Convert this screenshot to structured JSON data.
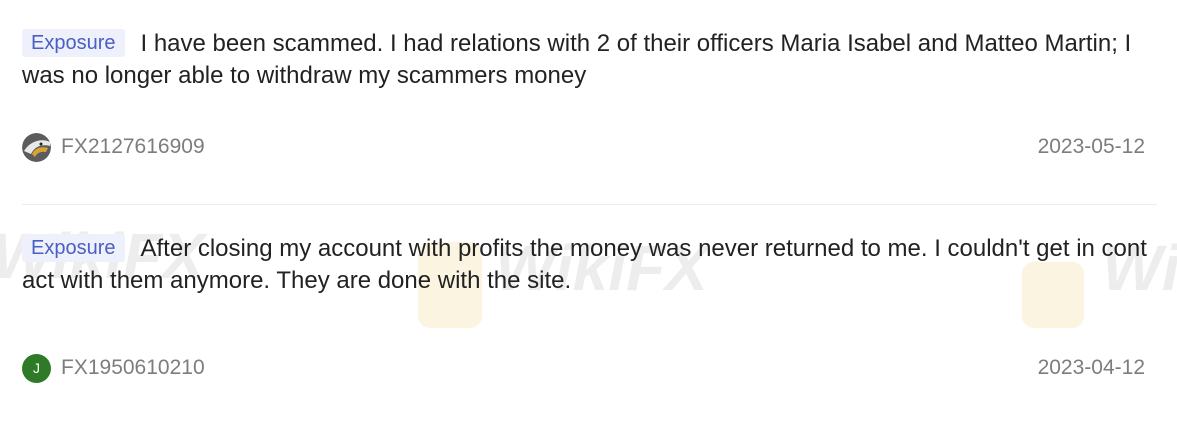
{
  "reviews": [
    {
      "tag": "Exposure",
      "text": "I have been scammed. I had relations with 2 of their officers Maria Isabel and Matteo Martin; I was no longer able to withdraw my scammers money",
      "user": "FX2127616909",
      "avatar_icon": "eagle-avatar",
      "date": "2023-05-12"
    },
    {
      "tag": "Exposure",
      "text": "After closing my account with profits the money was never returned to me. I couldn't get in contact with them anymore. They are done with the site.",
      "user": "FX1950610210",
      "avatar_letter": "J",
      "date": "2023-04-12"
    }
  ],
  "watermark": {
    "text": "WikiFX"
  },
  "colors": {
    "tag_bg": "#eef1fb",
    "tag_text": "#4a5fc1",
    "meta_text": "#7d7d7d",
    "avatar_green": "#2e7a26"
  }
}
